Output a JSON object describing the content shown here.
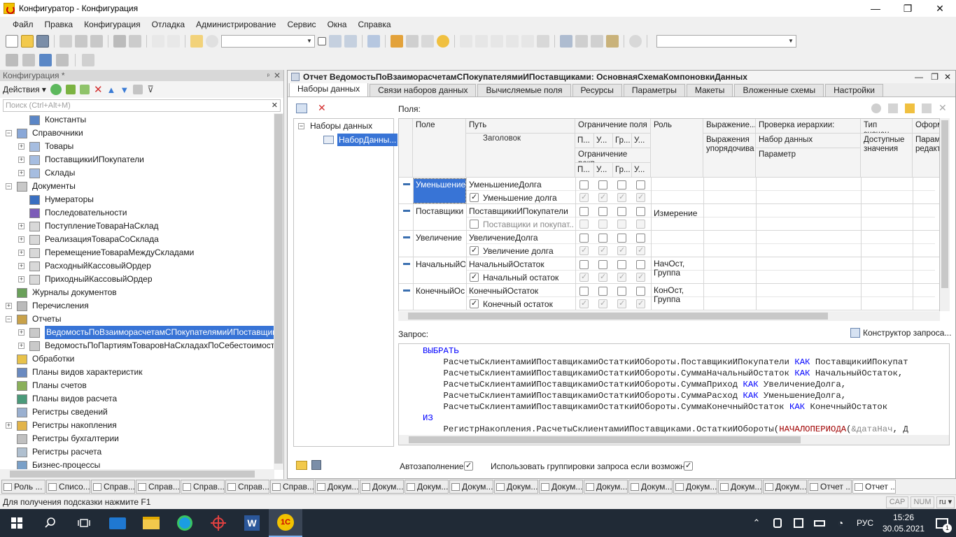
{
  "window": {
    "title": "Конфигуратор - Конфигурация",
    "minimize_glyph": "—",
    "maximize_glyph": "❐",
    "close_glyph": "✕"
  },
  "menu": [
    "Файл",
    "Правка",
    "Конфигурация",
    "Отладка",
    "Администрирование",
    "Сервис",
    "Окна",
    "Справка"
  ],
  "left_panel": {
    "title": "Конфигурация *",
    "pin_glyph": "ᵖ",
    "close_glyph": "✕",
    "actions_label": "Действия ▾",
    "search_placeholder": "Поиск (Ctrl+Alt+M)",
    "tree": [
      {
        "label": "Константы",
        "level": 1,
        "exp": "",
        "icon": "constants-icon"
      },
      {
        "label": "Справочники",
        "level": 0,
        "exp": "−",
        "icon": "catalogs-icon"
      },
      {
        "label": "Товары",
        "level": 1,
        "exp": "+",
        "icon": "catalog-icon"
      },
      {
        "label": "ПоставщикиИПокупатели",
        "level": 1,
        "exp": "+",
        "icon": "catalog-icon"
      },
      {
        "label": "Склады",
        "level": 1,
        "exp": "+",
        "icon": "catalog-icon"
      },
      {
        "label": "Документы",
        "level": 0,
        "exp": "−",
        "icon": "documents-icon"
      },
      {
        "label": "Нумераторы",
        "level": 1,
        "exp": "",
        "icon": "numerators-icon"
      },
      {
        "label": "Последовательности",
        "level": 1,
        "exp": "",
        "icon": "sequences-icon"
      },
      {
        "label": "ПоступлениеТовараНаСклад",
        "level": 1,
        "exp": "+",
        "icon": "document-icon"
      },
      {
        "label": "РеализацияТовараСоСклада",
        "level": 1,
        "exp": "+",
        "icon": "document-icon"
      },
      {
        "label": "ПеремещениеТовараМеждуСкладами",
        "level": 1,
        "exp": "+",
        "icon": "document-icon"
      },
      {
        "label": "РасходныйКассовыйОрдер",
        "level": 1,
        "exp": "+",
        "icon": "document-icon"
      },
      {
        "label": "ПриходныйКассовыйОрдер",
        "level": 1,
        "exp": "+",
        "icon": "document-icon"
      },
      {
        "label": "Журналы документов",
        "level": 0.5,
        "exp": "",
        "icon": "journals-icon"
      },
      {
        "label": "Перечисления",
        "level": 0,
        "exp": "+",
        "icon": "enums-icon"
      },
      {
        "label": "Отчеты",
        "level": 0,
        "exp": "−",
        "icon": "reports-icon"
      },
      {
        "label": "ВедомостьПоВзаиморасчетамСПокупателямиИПоставщиками",
        "level": 1,
        "exp": "+",
        "icon": "report-icon",
        "selected": true
      },
      {
        "label": "ВедомостьПоПартиямТоваровНаСкладахПоСебестоимости",
        "level": 1,
        "exp": "+",
        "icon": "report-icon"
      },
      {
        "label": "Обработки",
        "level": 0.5,
        "exp": "",
        "icon": "dataprocessors-icon"
      },
      {
        "label": "Планы видов характеристик",
        "level": 0.5,
        "exp": "",
        "icon": "chartsofcharacteristics-icon"
      },
      {
        "label": "Планы счетов",
        "level": 0.5,
        "exp": "",
        "icon": "chartsofaccounts-icon"
      },
      {
        "label": "Планы видов расчета",
        "level": 0.5,
        "exp": "",
        "icon": "chartsofcalculation-icon"
      },
      {
        "label": "Регистры сведений",
        "level": 0.5,
        "exp": "",
        "icon": "inforegisters-icon"
      },
      {
        "label": "Регистры накопления",
        "level": 0,
        "exp": "+",
        "icon": "accumregisters-icon"
      },
      {
        "label": "Регистры бухгалтерии",
        "level": 0.5,
        "exp": "",
        "icon": "accountingregisters-icon"
      },
      {
        "label": "Регистры расчета",
        "level": 0.5,
        "exp": "",
        "icon": "calcregisters-icon"
      },
      {
        "label": "Бизнес-процессы",
        "level": 0.5,
        "exp": "",
        "icon": "businessprocesses-icon"
      }
    ]
  },
  "right_panel": {
    "title": "Отчет ВедомостьПоВзаиморасчетамСПокупателямиИПоставщиками: ОсновнаяСхемаКомпоновкиДанных",
    "tabs": [
      "Наборы данных",
      "Связи наборов данных",
      "Вычисляемые поля",
      "Ресурсы",
      "Параметры",
      "Макеты",
      "Вложенные схемы",
      "Настройки"
    ],
    "fields_label": "Поля:",
    "datasets_root": "Наборы данных",
    "dataset_item": "НаборДанны...",
    "grid_headers": {
      "field": "Поле",
      "path": "Путь",
      "title": "Заголовок",
      "field_restriction": "Ограничение поля",
      "req_restriction": "Ограничение рекв...",
      "p": "П...",
      "u": "У...",
      "gr": "Гр...",
      "u2": "У...",
      "role": "Роль",
      "expression": "Выражение...",
      "order_expr": "Выражения упорядочива",
      "hier_check": "Проверка иерархии:",
      "hier_dataset": "Набор данных",
      "hier_param": "Параметр",
      "value_type": "Тип значен...",
      "avail_values": "Доступные значения",
      "format": "Оформ...",
      "format2": "Парам редакт"
    },
    "rows": [
      {
        "field": "Уменьшение",
        "path": "УменьшениеДолга",
        "title": "Уменьшение долга",
        "title_checked": true,
        "role": "",
        "restr": [
          false,
          false,
          false,
          false
        ],
        "req": [
          true,
          true,
          true,
          true
        ],
        "selected": true
      },
      {
        "field": "Поставщики",
        "path": "ПоставщикиИПокупатели",
        "title": "Поставщики и покупат...",
        "title_checked": false,
        "role": "Измерение",
        "restr": [
          false,
          false,
          false,
          false
        ],
        "req": [
          false,
          false,
          false,
          false
        ]
      },
      {
        "field": "Увеличение",
        "path": "УвеличениеДолга",
        "title": "Увеличение долга",
        "title_checked": true,
        "role": "",
        "restr": [
          false,
          false,
          false,
          false
        ],
        "req": [
          true,
          true,
          true,
          true
        ]
      },
      {
        "field": "НачальныйО",
        "path": "НачальныйОстаток",
        "title": "Начальный остаток",
        "title_checked": true,
        "role": "НачОст, Группа",
        "restr": [
          false,
          false,
          false,
          false
        ],
        "req": [
          true,
          true,
          true,
          true
        ]
      },
      {
        "field": "КонечныйОс",
        "path": "КонечныйОстаток",
        "title": "Конечный остаток",
        "title_checked": true,
        "role": "КонОст, Группа",
        "restr": [
          false,
          false,
          false,
          false
        ],
        "req": [
          true,
          true,
          true,
          true
        ]
      }
    ],
    "query_label": "Запрос:",
    "query_builder": "Конструктор запроса...",
    "query_lines": [
      [
        {
          "t": "ВЫБРАТЬ",
          "c": "kw"
        }
      ],
      [
        {
          "t": "    РасчетыСклиентамиИПоставщикамиОстаткиИОбороты.ПоставщикиИПокупатели ",
          "c": ""
        },
        {
          "t": "КАК",
          "c": "kw"
        },
        {
          "t": " ПоставщикиИПокупат",
          "c": ""
        }
      ],
      [
        {
          "t": "    РасчетыСклиентамиИПоставщикамиОстаткиИОбороты.СуммаНачальныйОстаток ",
          "c": ""
        },
        {
          "t": "КАК",
          "c": "kw"
        },
        {
          "t": " НачальныйОстаток,",
          "c": ""
        }
      ],
      [
        {
          "t": "    РасчетыСклиентамиИПоставщикамиОстаткиИОбороты.СуммаПриход ",
          "c": ""
        },
        {
          "t": "КАК",
          "c": "kw"
        },
        {
          "t": " УвеличениеДолга,",
          "c": ""
        }
      ],
      [
        {
          "t": "    РасчетыСклиентамиИПоставщикамиОстаткиИОбороты.СуммаРасход ",
          "c": ""
        },
        {
          "t": "КАК",
          "c": "kw"
        },
        {
          "t": " УменьшениеДолга,",
          "c": ""
        }
      ],
      [
        {
          "t": "    РасчетыСклиентамиИПоставщикамиОстаткиИОбороты.СуммаКонечныйОстаток ",
          "c": ""
        },
        {
          "t": "КАК",
          "c": "kw"
        },
        {
          "t": " КонечныйОстаток",
          "c": ""
        }
      ],
      [
        {
          "t": "ИЗ",
          "c": "kw"
        }
      ],
      [
        {
          "t": "    РегистрНакопления.РасчетыСклиентамиИПоставщиками.ОстаткиИОбороты(",
          "c": ""
        },
        {
          "t": "НАЧАЛОПЕРИОДА",
          "c": "fn"
        },
        {
          "t": "(",
          "c": ""
        },
        {
          "t": "&датаНач",
          "c": "par"
        },
        {
          "t": ", Д",
          "c": ""
        }
      ]
    ],
    "autofill_label": "Автозаполнение",
    "use_grouping_label": "Использовать группировки запроса если возможно"
  },
  "window_tabs": [
    "Роль ...",
    "Списо...",
    "Справ...",
    "Справ...",
    "Справ...",
    "Справ...",
    "Справ...",
    "Докум...",
    "Докум...",
    "Докум...",
    "Докум...",
    "Докум...",
    "Докум...",
    "Докум...",
    "Докум...",
    "Докум...",
    "Докум...",
    "Докум...",
    "Отчет ...",
    "Отчет ..."
  ],
  "status": {
    "hint": "Для получения подсказки нажмите F1",
    "cap": "CAP",
    "num": "NUM",
    "lang": "ru ▾"
  },
  "os_taskbar": {
    "lang": "РУС",
    "time": "15:26",
    "date": "30.05.2021",
    "notifications": "1"
  }
}
